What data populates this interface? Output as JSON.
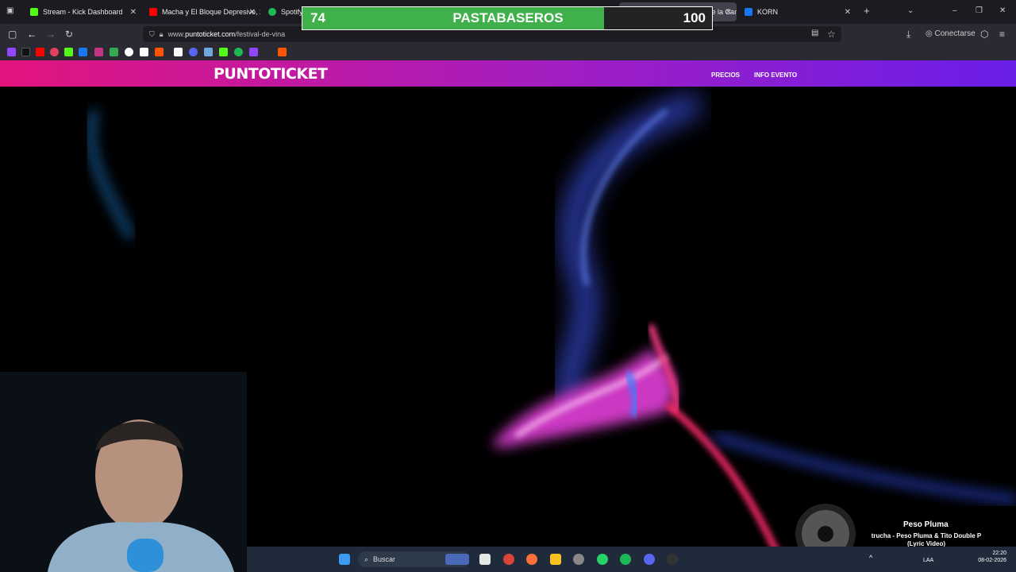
{
  "tabs": [
    {
      "title": "Stream - Kick Dashboard",
      "icon": "kick-icon",
      "color": "#53fc18"
    },
    {
      "title": "Macha y El Bloque Depresivo, 2…",
      "icon": "youtube-icon",
      "color": "#ff0000"
    },
    {
      "title": "Spotify",
      "icon": "spotify-icon",
      "color": "#1db954"
    },
    {
      "title": "Festival Internacional de la Can…",
      "icon": "puntoticket-icon",
      "color": "#e3147e"
    },
    {
      "title": "KORN",
      "icon": "page-icon",
      "color": "#1877f2"
    }
  ],
  "browser": {
    "url_prefix": "www.",
    "url_domain": "puntoticket.com",
    "url_path": "/festival-de-vina",
    "account_label": "Conectarse"
  },
  "site": {
    "logo": "PUNTOTICKET",
    "nav": [
      "PRECIOS",
      "INFO EVENTO"
    ]
  },
  "overlay": {
    "score_left": "74",
    "title": "PASTABASEROS",
    "score_right": "100",
    "left_color": "#3fb04a"
  },
  "taskbar": {
    "search_placeholder": "Buscar",
    "time": "22:20",
    "date": "08-02-2026",
    "lang": "LAA"
  },
  "now_playing": {
    "artist": "Peso Pluma",
    "track": "trucha - Peso Pluma & Tito Double P (Lyric Video)"
  }
}
